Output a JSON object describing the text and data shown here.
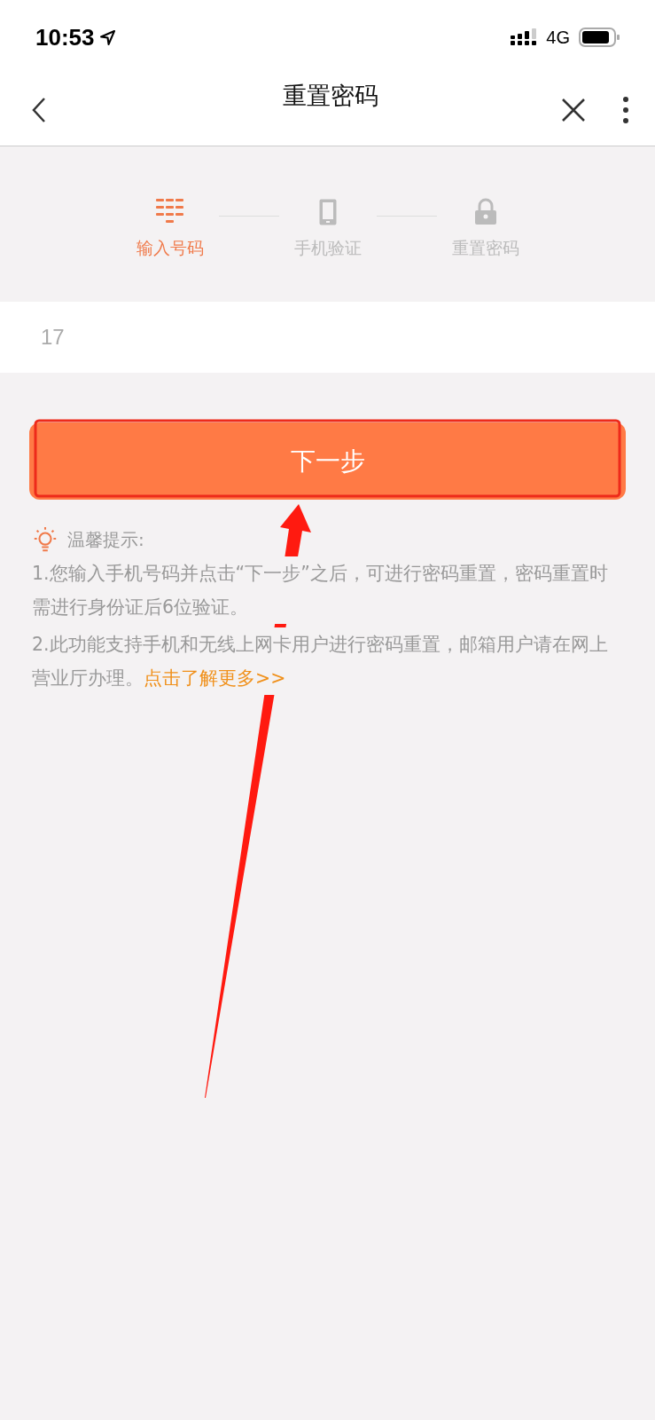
{
  "status_bar": {
    "time": "10:53",
    "network": "4G"
  },
  "header": {
    "title": "重置密码"
  },
  "steps": [
    {
      "kind": "keypad",
      "label": "输入号码",
      "selected": true
    },
    {
      "kind": "phone",
      "label": "手机验证",
      "selected": false
    },
    {
      "kind": "lock",
      "label": "重置密码",
      "selected": false
    }
  ],
  "phone_field": {
    "value": "17"
  },
  "next_button": "下一步",
  "tips": {
    "title": "温馨提示:",
    "items": [
      {
        "text": "1.您输入手机号码并点击“下一步”之后，可进行密码重置，密码重置时需进行身份证后6位验证。"
      },
      {
        "text": "2.此功能支持手机和无线上网卡用户进行密码重置，邮箱用户请在网上营业厅办理。",
        "link": "点击了解更多>>"
      }
    ]
  }
}
